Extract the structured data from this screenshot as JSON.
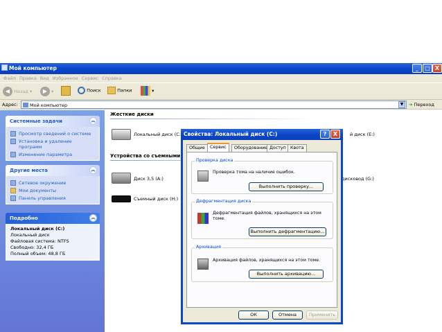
{
  "window": {
    "title": "Мой компьютер",
    "min_glyph": "_",
    "max_glyph": "□",
    "close_glyph": "X"
  },
  "menu": [
    "Файл",
    "Правка",
    "Вид",
    "Избранное",
    "Сервис",
    "Справка"
  ],
  "toolbar": {
    "back": "Назад",
    "search": "Поиск",
    "folders": "Папки"
  },
  "address": {
    "label": "Адрес:",
    "value": "Мой компьютер",
    "go": "Переход"
  },
  "sidebar": {
    "tasks": {
      "title": "Системные задачи",
      "items": [
        "Просмотр сведений о системе",
        "Установка и удаление программ",
        "Изменение параметра"
      ]
    },
    "places": {
      "title": "Другие места",
      "items": [
        "Сетевое окружение",
        "Мои документы",
        "Панель управления"
      ]
    },
    "details": {
      "title": "Подробно",
      "name": "Локальный диск (C:)",
      "type": "Локальный диск",
      "fs": "Файловая система: NTFS",
      "free": "Свободно: 32,4 ГБ",
      "total": "Полный объем: 48,8 ГБ"
    }
  },
  "content": {
    "hdd_group": "Жесткие диски",
    "removable_group": "Устройства со съемными но",
    "drive_c": "Локальный диск (C:)",
    "drive_e": "й диск (E:)",
    "floppy": "Диск 3,5 (A:)",
    "removable_h": "Съемный диск (H:)",
    "dvd_g": "дисковод (G:)"
  },
  "dialog": {
    "title": "Свойства: Локальный диск (C:)",
    "help_glyph": "?",
    "close_glyph": "X",
    "tabs": [
      "Общие",
      "Сервис",
      "Оборудование",
      "Доступ",
      "Квота"
    ],
    "check": {
      "label": "Проверка диска",
      "text": "Проверка тома на наличие ошибок.",
      "button": "Выполнить проверку..."
    },
    "defrag": {
      "label": "Дефрагментация диска",
      "text": "Дефрагментация файлов, хранящихся на этом томе.",
      "button": "Выполнить дефрагментацию..."
    },
    "archive": {
      "label": "Архивация",
      "text": "Архивация файлов, хранящихся на этом томе.",
      "button": "Выполнить архивацию..."
    },
    "ok": "ОК",
    "cancel": "Отмена",
    "apply": "Применить"
  }
}
